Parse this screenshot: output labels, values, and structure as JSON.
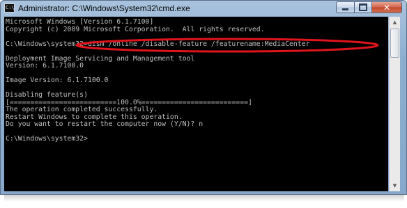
{
  "window": {
    "title": "Administrator: C:\\Windows\\System32\\cmd.exe",
    "icon": "cmd-icon",
    "controls": {
      "minimize": "minimize-icon",
      "maximize": "maximize-icon",
      "close": "close-icon",
      "close_glyph": "✕"
    }
  },
  "console": {
    "text": "Microsoft Windows [Version 6.1.7100]\nCopyright (c) 2009 Microsoft Corporation.  All rights reserved.\n\nC:\\Windows\\system32>dism /online /disable-feature /featurename:MediaCenter\n\nDeployment Image Servicing and Management tool\nVersion: 6.1.7100.0\n\nImage Version: 6.1.7100.0\n\nDisabling feature(s)\n[==========================100.0%==========================]\nThe operation completed successfully.\nRestart Windows to complete this operation.\nDo you want to restart the computer now (Y/N)? n\n\nC:\\Windows\\system32>"
  },
  "annotation": {
    "color": "#e0141b",
    "highlights": "dism command line"
  },
  "colors": {
    "console_bg": "#000000",
    "console_fg": "#c0c0c0",
    "frame": "#8eaecf"
  }
}
